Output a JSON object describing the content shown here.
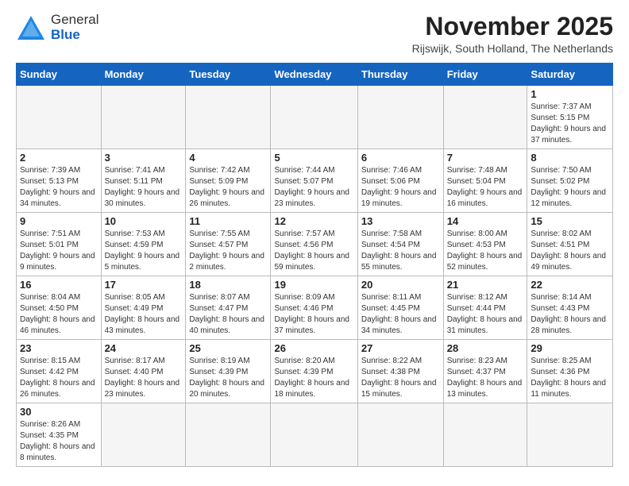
{
  "header": {
    "logo_general": "General",
    "logo_blue": "Blue",
    "month": "November 2025",
    "location": "Rijswijk, South Holland, The Netherlands"
  },
  "weekdays": [
    "Sunday",
    "Monday",
    "Tuesday",
    "Wednesday",
    "Thursday",
    "Friday",
    "Saturday"
  ],
  "weeks": [
    [
      {
        "day": "",
        "info": ""
      },
      {
        "day": "",
        "info": ""
      },
      {
        "day": "",
        "info": ""
      },
      {
        "day": "",
        "info": ""
      },
      {
        "day": "",
        "info": ""
      },
      {
        "day": "",
        "info": ""
      },
      {
        "day": "1",
        "info": "Sunrise: 7:37 AM\nSunset: 5:15 PM\nDaylight: 9 hours\nand 37 minutes."
      }
    ],
    [
      {
        "day": "2",
        "info": "Sunrise: 7:39 AM\nSunset: 5:13 PM\nDaylight: 9 hours\nand 34 minutes."
      },
      {
        "day": "3",
        "info": "Sunrise: 7:41 AM\nSunset: 5:11 PM\nDaylight: 9 hours\nand 30 minutes."
      },
      {
        "day": "4",
        "info": "Sunrise: 7:42 AM\nSunset: 5:09 PM\nDaylight: 9 hours\nand 26 minutes."
      },
      {
        "day": "5",
        "info": "Sunrise: 7:44 AM\nSunset: 5:07 PM\nDaylight: 9 hours\nand 23 minutes."
      },
      {
        "day": "6",
        "info": "Sunrise: 7:46 AM\nSunset: 5:06 PM\nDaylight: 9 hours\nand 19 minutes."
      },
      {
        "day": "7",
        "info": "Sunrise: 7:48 AM\nSunset: 5:04 PM\nDaylight: 9 hours\nand 16 minutes."
      },
      {
        "day": "8",
        "info": "Sunrise: 7:50 AM\nSunset: 5:02 PM\nDaylight: 9 hours\nand 12 minutes."
      }
    ],
    [
      {
        "day": "9",
        "info": "Sunrise: 7:51 AM\nSunset: 5:01 PM\nDaylight: 9 hours\nand 9 minutes."
      },
      {
        "day": "10",
        "info": "Sunrise: 7:53 AM\nSunset: 4:59 PM\nDaylight: 9 hours\nand 5 minutes."
      },
      {
        "day": "11",
        "info": "Sunrise: 7:55 AM\nSunset: 4:57 PM\nDaylight: 9 hours\nand 2 minutes."
      },
      {
        "day": "12",
        "info": "Sunrise: 7:57 AM\nSunset: 4:56 PM\nDaylight: 8 hours\nand 59 minutes."
      },
      {
        "day": "13",
        "info": "Sunrise: 7:58 AM\nSunset: 4:54 PM\nDaylight: 8 hours\nand 55 minutes."
      },
      {
        "day": "14",
        "info": "Sunrise: 8:00 AM\nSunset: 4:53 PM\nDaylight: 8 hours\nand 52 minutes."
      },
      {
        "day": "15",
        "info": "Sunrise: 8:02 AM\nSunset: 4:51 PM\nDaylight: 8 hours\nand 49 minutes."
      }
    ],
    [
      {
        "day": "16",
        "info": "Sunrise: 8:04 AM\nSunset: 4:50 PM\nDaylight: 8 hours\nand 46 minutes."
      },
      {
        "day": "17",
        "info": "Sunrise: 8:05 AM\nSunset: 4:49 PM\nDaylight: 8 hours\nand 43 minutes."
      },
      {
        "day": "18",
        "info": "Sunrise: 8:07 AM\nSunset: 4:47 PM\nDaylight: 8 hours\nand 40 minutes."
      },
      {
        "day": "19",
        "info": "Sunrise: 8:09 AM\nSunset: 4:46 PM\nDaylight: 8 hours\nand 37 minutes."
      },
      {
        "day": "20",
        "info": "Sunrise: 8:11 AM\nSunset: 4:45 PM\nDaylight: 8 hours\nand 34 minutes."
      },
      {
        "day": "21",
        "info": "Sunrise: 8:12 AM\nSunset: 4:44 PM\nDaylight: 8 hours\nand 31 minutes."
      },
      {
        "day": "22",
        "info": "Sunrise: 8:14 AM\nSunset: 4:43 PM\nDaylight: 8 hours\nand 28 minutes."
      }
    ],
    [
      {
        "day": "23",
        "info": "Sunrise: 8:15 AM\nSunset: 4:42 PM\nDaylight: 8 hours\nand 26 minutes."
      },
      {
        "day": "24",
        "info": "Sunrise: 8:17 AM\nSunset: 4:40 PM\nDaylight: 8 hours\nand 23 minutes."
      },
      {
        "day": "25",
        "info": "Sunrise: 8:19 AM\nSunset: 4:39 PM\nDaylight: 8 hours\nand 20 minutes."
      },
      {
        "day": "26",
        "info": "Sunrise: 8:20 AM\nSunset: 4:39 PM\nDaylight: 8 hours\nand 18 minutes."
      },
      {
        "day": "27",
        "info": "Sunrise: 8:22 AM\nSunset: 4:38 PM\nDaylight: 8 hours\nand 15 minutes."
      },
      {
        "day": "28",
        "info": "Sunrise: 8:23 AM\nSunset: 4:37 PM\nDaylight: 8 hours\nand 13 minutes."
      },
      {
        "day": "29",
        "info": "Sunrise: 8:25 AM\nSunset: 4:36 PM\nDaylight: 8 hours\nand 11 minutes."
      }
    ],
    [
      {
        "day": "30",
        "info": "Sunrise: 8:26 AM\nSunset: 4:35 PM\nDaylight: 8 hours\nand 8 minutes."
      },
      {
        "day": "",
        "info": ""
      },
      {
        "day": "",
        "info": ""
      },
      {
        "day": "",
        "info": ""
      },
      {
        "day": "",
        "info": ""
      },
      {
        "day": "",
        "info": ""
      },
      {
        "day": "",
        "info": ""
      }
    ]
  ]
}
